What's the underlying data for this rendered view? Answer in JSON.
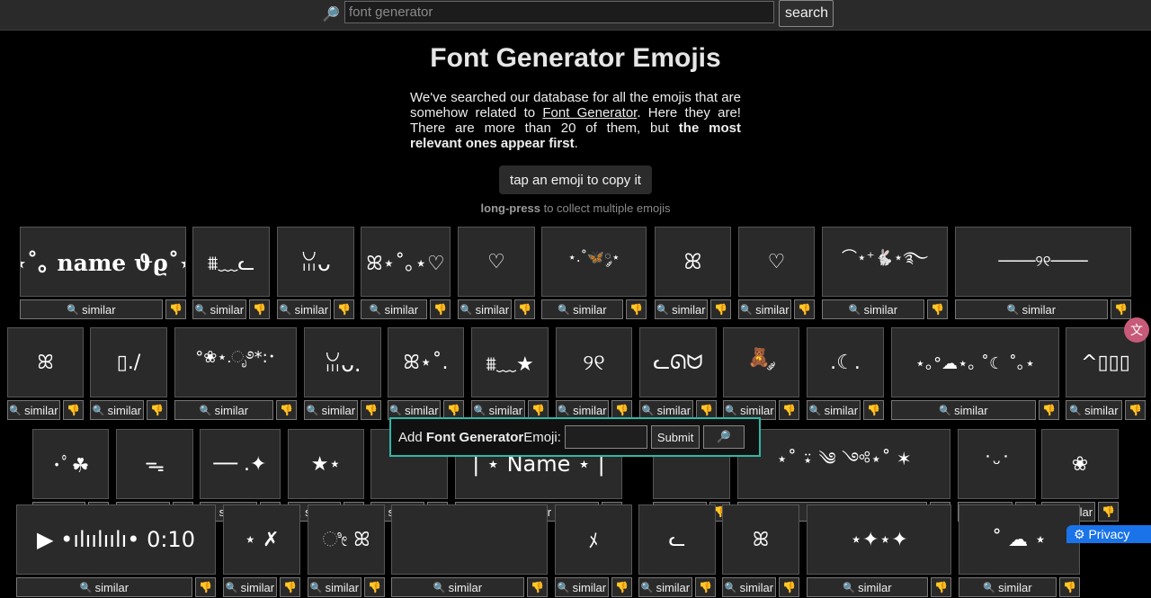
{
  "search": {
    "placeholder": "font generator",
    "button": "search"
  },
  "page_title": "Font Generator Emojis",
  "intro": {
    "part1": "We've searched our database for all the emojis that are somehow related to ",
    "link": "Font Generator",
    "part2": ". Here they are! There are more than 20 of them, but ",
    "bold": "the most relevant ones appear first",
    "part3": "."
  },
  "tap_button": "tap an emoji to copy it",
  "hint": {
    "bold": "long-press",
    "rest": " to collect multiple emojis"
  },
  "similar_label": "similar",
  "popup": {
    "prefix": "Add ",
    "bold": "Font Generator",
    "suffix": " Emoji:",
    "submit": "Submit"
  },
  "privacy": "Privacy",
  "rows": [
    [
      "⋆˚｡ name ϑϱ˚⋆",
      "⩩﹏ᓚ",
      "ꈍᴗ",
      "ꕤ⋆˚｡⋆♡",
      "♡",
      "⋆.˚🦋༘⋆",
      "ꕤ",
      "♡",
      "⌒⋆⁺🐇⋆࿐",
      "────୨୧────"
    ],
    [
      "ꕤ",
      "▯./",
      "°❀⋆.ೃ࿔*:･",
      "ꈍᴗ.",
      "ꕤ⋆˚.",
      "⩩﹏★",
      "୨୧",
      "ᓚᘏᗢ",
      "🧸 ༘",
      ".☾.",
      "⋆｡°☁︎⋆｡ ˚☾ ˚｡⋆",
      "^▯▯▯"
    ],
    [
      "･ﾟ☘",
      "ᯓ",
      "── .✦",
      "★⋆",
      "",
      "| ⋆ Name ⋆ |",
      "",
      "⋆˚ ⍣ ༄ ༺⋆˚ ✶",
      "˙ᵕ˙",
      "❀"
    ],
    [
      "▶ •ılıılıılı• 0:10",
      "⋆ ✗",
      "ೀ ꕤ",
      "",
      "ﾒ",
      "ᓚ",
      "ꕤ",
      "⋆✦⋆✦",
      "˚ ☁︎ ⋆"
    ]
  ]
}
